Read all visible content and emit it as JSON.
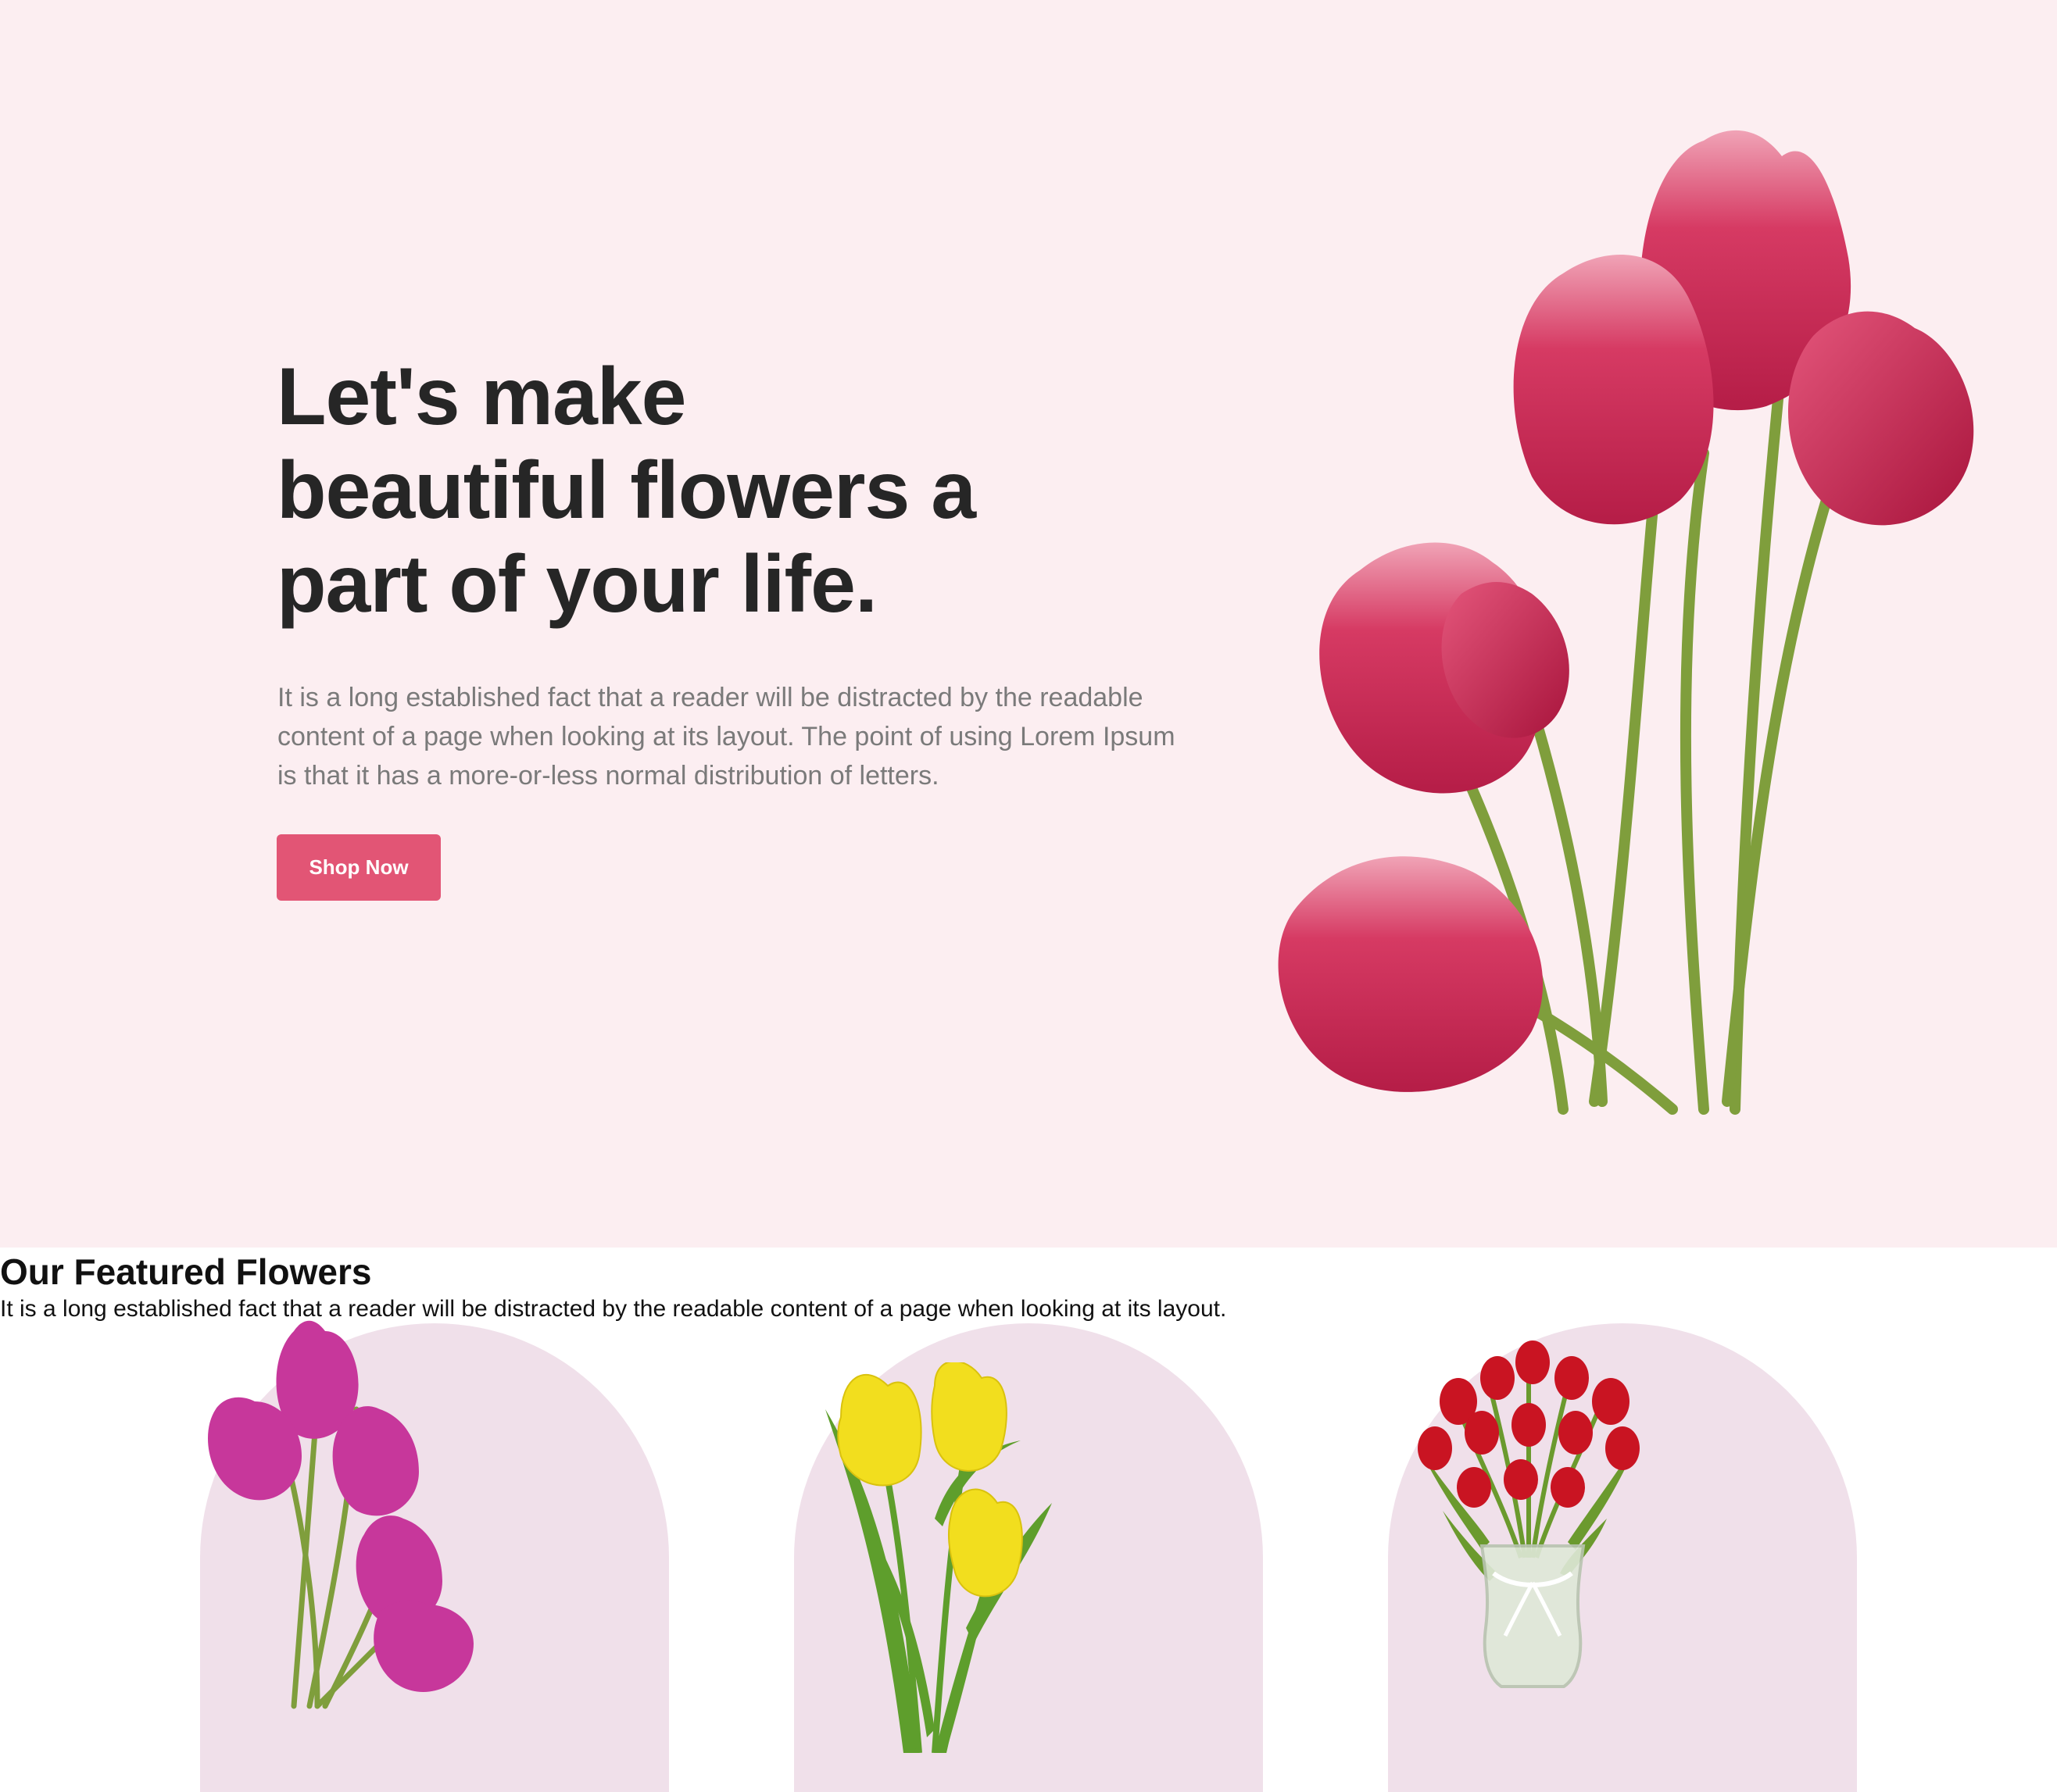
{
  "hero": {
    "title": "Let's make beautiful flowers a part of your life.",
    "description": "It is a long established fact that a reader will be distracted by the readable content of a page when looking at its layout. The point of using Lorem Ipsum is that it has a more-or-less normal distribution of letters.",
    "button_label": "Shop Now"
  },
  "featured": {
    "title": "Our Featured Flowers",
    "subtitle": "It is a long established fact that a reader will be distracted by the readable content of a page when looking at its layout.",
    "cards": [
      {
        "image": "pink-tulips-bouquet-icon"
      },
      {
        "image": "yellow-tulips-icon"
      },
      {
        "image": "red-tulips-vase-icon"
      }
    ]
  },
  "colors": {
    "hero_background": "#fceef1",
    "button": "#e25575",
    "card_background": "#f0e0ea",
    "heading": "#262626",
    "body_text": "#7a7a7a"
  }
}
